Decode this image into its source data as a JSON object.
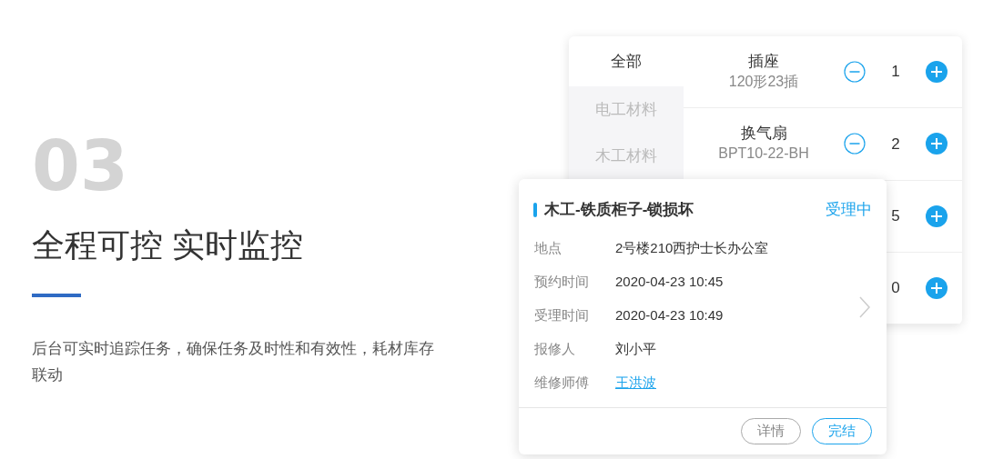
{
  "section": {
    "number": "03",
    "title": "全程可控 实时监控",
    "description": "后台可实时追踪任务，确保任务及时性和有效性，耗材库存联动"
  },
  "categories": [
    {
      "label": "全部",
      "selected": true
    },
    {
      "label": "电工材料",
      "selected": false
    },
    {
      "label": "木工材料",
      "selected": false
    }
  ],
  "products": [
    {
      "name": "插座",
      "spec": "120形23插",
      "quantity": "1"
    },
    {
      "name": "换气扇",
      "spec": "BPT10-22-BH",
      "quantity": "2"
    },
    {
      "quantity": "5"
    },
    {
      "quantity": "0"
    }
  ],
  "order_card": {
    "title": "木工-铁质柜子-锁损坏",
    "status": "受理中",
    "fields": [
      {
        "label": "地点",
        "value": "2号楼210西护士长办公室",
        "kind": "text"
      },
      {
        "label": "预约时间",
        "value": "2020-04-23 10:45",
        "kind": "text"
      },
      {
        "label": "受理时间",
        "value": "2020-04-23 10:49",
        "kind": "text"
      },
      {
        "label": "报修人",
        "value": "刘小平",
        "kind": "text"
      },
      {
        "label": "维修师傅",
        "value": "王洪波",
        "kind": "link"
      }
    ],
    "buttons": [
      {
        "label": "详情",
        "kind": "secondary"
      },
      {
        "label": "完结",
        "kind": "primary"
      }
    ]
  }
}
